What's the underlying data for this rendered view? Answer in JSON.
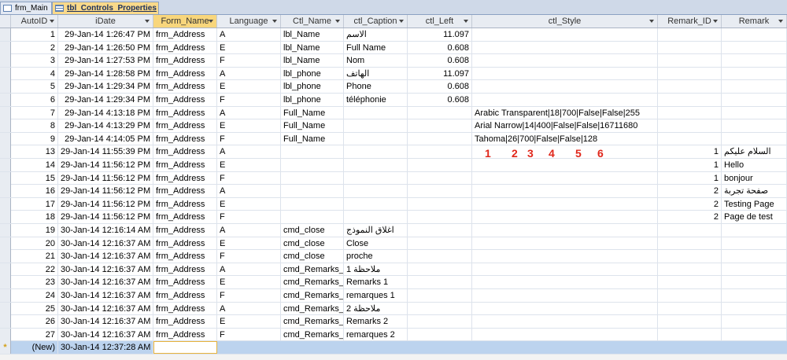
{
  "tabs": [
    {
      "label": "frm_Main",
      "icon": "form-icon"
    },
    {
      "label": "tbl_Controls_Properties",
      "icon": "table-icon"
    }
  ],
  "columns": [
    "AutoID",
    "iDate",
    "Form_Name",
    "Language",
    "Ctl_Name",
    "ctl_Caption",
    "ctl_Left",
    "ctl_Style",
    "Remark_ID",
    "Remark"
  ],
  "rows": [
    [
      "1",
      "29-Jan-14 1:26:47 PM",
      "frm_Address",
      "A",
      "lbl_Name",
      "الاسم",
      "11.097",
      "",
      "",
      ""
    ],
    [
      "2",
      "29-Jan-14 1:26:50 PM",
      "frm_Address",
      "E",
      "lbl_Name",
      "Full Name",
      "0.608",
      "",
      "",
      ""
    ],
    [
      "3",
      "29-Jan-14 1:27:53 PM",
      "frm_Address",
      "F",
      "lbl_Name",
      "Nom",
      "0.608",
      "",
      "",
      ""
    ],
    [
      "4",
      "29-Jan-14 1:28:58 PM",
      "frm_Address",
      "A",
      "lbl_phone",
      "الهاتف",
      "11.097",
      "",
      "",
      ""
    ],
    [
      "5",
      "29-Jan-14 1:29:34 PM",
      "frm_Address",
      "E",
      "lbl_phone",
      "Phone",
      "0.608",
      "",
      "",
      ""
    ],
    [
      "6",
      "29-Jan-14 1:29:34 PM",
      "frm_Address",
      "F",
      "lbl_phone",
      "téléphonie",
      "0.608",
      "",
      "",
      ""
    ],
    [
      "7",
      "29-Jan-14 4:13:18 PM",
      "frm_Address",
      "A",
      "Full_Name",
      "",
      "",
      "Arabic Transparent|18|700|False|False|255",
      "",
      ""
    ],
    [
      "8",
      "29-Jan-14 4:13:29 PM",
      "frm_Address",
      "E",
      "Full_Name",
      "",
      "",
      "Arial Narrow|14|400|False|False|16711680",
      "",
      ""
    ],
    [
      "9",
      "29-Jan-14 4:14:05 PM",
      "frm_Address",
      "F",
      "Full_Name",
      "",
      "",
      "Tahoma|26|700|False|False|128",
      "",
      ""
    ],
    [
      "13",
      "29-Jan-14 11:55:39 PM",
      "frm_Address",
      "A",
      "",
      "",
      "",
      "",
      "1",
      "السلام عليكم"
    ],
    [
      "14",
      "29-Jan-14 11:56:12 PM",
      "frm_Address",
      "E",
      "",
      "",
      "",
      "",
      "1",
      "Hello"
    ],
    [
      "15",
      "29-Jan-14 11:56:12 PM",
      "frm_Address",
      "F",
      "",
      "",
      "",
      "",
      "1",
      "bonjour"
    ],
    [
      "16",
      "29-Jan-14 11:56:12 PM",
      "frm_Address",
      "A",
      "",
      "",
      "",
      "",
      "2",
      "صفحة تجربة"
    ],
    [
      "17",
      "29-Jan-14 11:56:12 PM",
      "frm_Address",
      "E",
      "",
      "",
      "",
      "",
      "2",
      "Testing Page"
    ],
    [
      "18",
      "29-Jan-14 11:56:12 PM",
      "frm_Address",
      "F",
      "",
      "",
      "",
      "",
      "2",
      "Page de test"
    ],
    [
      "19",
      "30-Jan-14 12:16:14 AM",
      "frm_Address",
      "A",
      "cmd_close",
      "اغلاق النموذج",
      "",
      "",
      "",
      ""
    ],
    [
      "20",
      "30-Jan-14 12:16:37 AM",
      "frm_Address",
      "E",
      "cmd_close",
      "Close",
      "",
      "",
      "",
      ""
    ],
    [
      "21",
      "30-Jan-14 12:16:37 AM",
      "frm_Address",
      "F",
      "cmd_close",
      "proche",
      "",
      "",
      "",
      ""
    ],
    [
      "22",
      "30-Jan-14 12:16:37 AM",
      "frm_Address",
      "A",
      "cmd_Remarks_",
      "ملاحظة 1",
      "",
      "",
      "",
      ""
    ],
    [
      "23",
      "30-Jan-14 12:16:37 AM",
      "frm_Address",
      "E",
      "cmd_Remarks_",
      "Remarks 1",
      "",
      "",
      "",
      ""
    ],
    [
      "24",
      "30-Jan-14 12:16:37 AM",
      "frm_Address",
      "F",
      "cmd_Remarks_",
      "remarques 1",
      "",
      "",
      "",
      ""
    ],
    [
      "25",
      "30-Jan-14 12:16:37 AM",
      "frm_Address",
      "A",
      "cmd_Remarks_",
      "ملاحظة 2",
      "",
      "",
      "",
      ""
    ],
    [
      "26",
      "30-Jan-14 12:16:37 AM",
      "frm_Address",
      "E",
      "cmd_Remarks_",
      "Remarks 2",
      "",
      "",
      "",
      ""
    ],
    [
      "27",
      "30-Jan-14 12:16:37 AM",
      "frm_Address",
      "F",
      "cmd_Remarks_",
      "remarques 2",
      "",
      "",
      "",
      ""
    ]
  ],
  "new_row": {
    "marker": "*",
    "autoid": "(New)",
    "idate": "30-Jan-14 12:37:28 AM"
  },
  "annotations": [
    "1",
    "2",
    "3",
    "4",
    "5",
    "6"
  ],
  "colors": {
    "annotation": "#e0271b",
    "new_row": "#bcd3ee",
    "active_header": "#f8d67c"
  }
}
